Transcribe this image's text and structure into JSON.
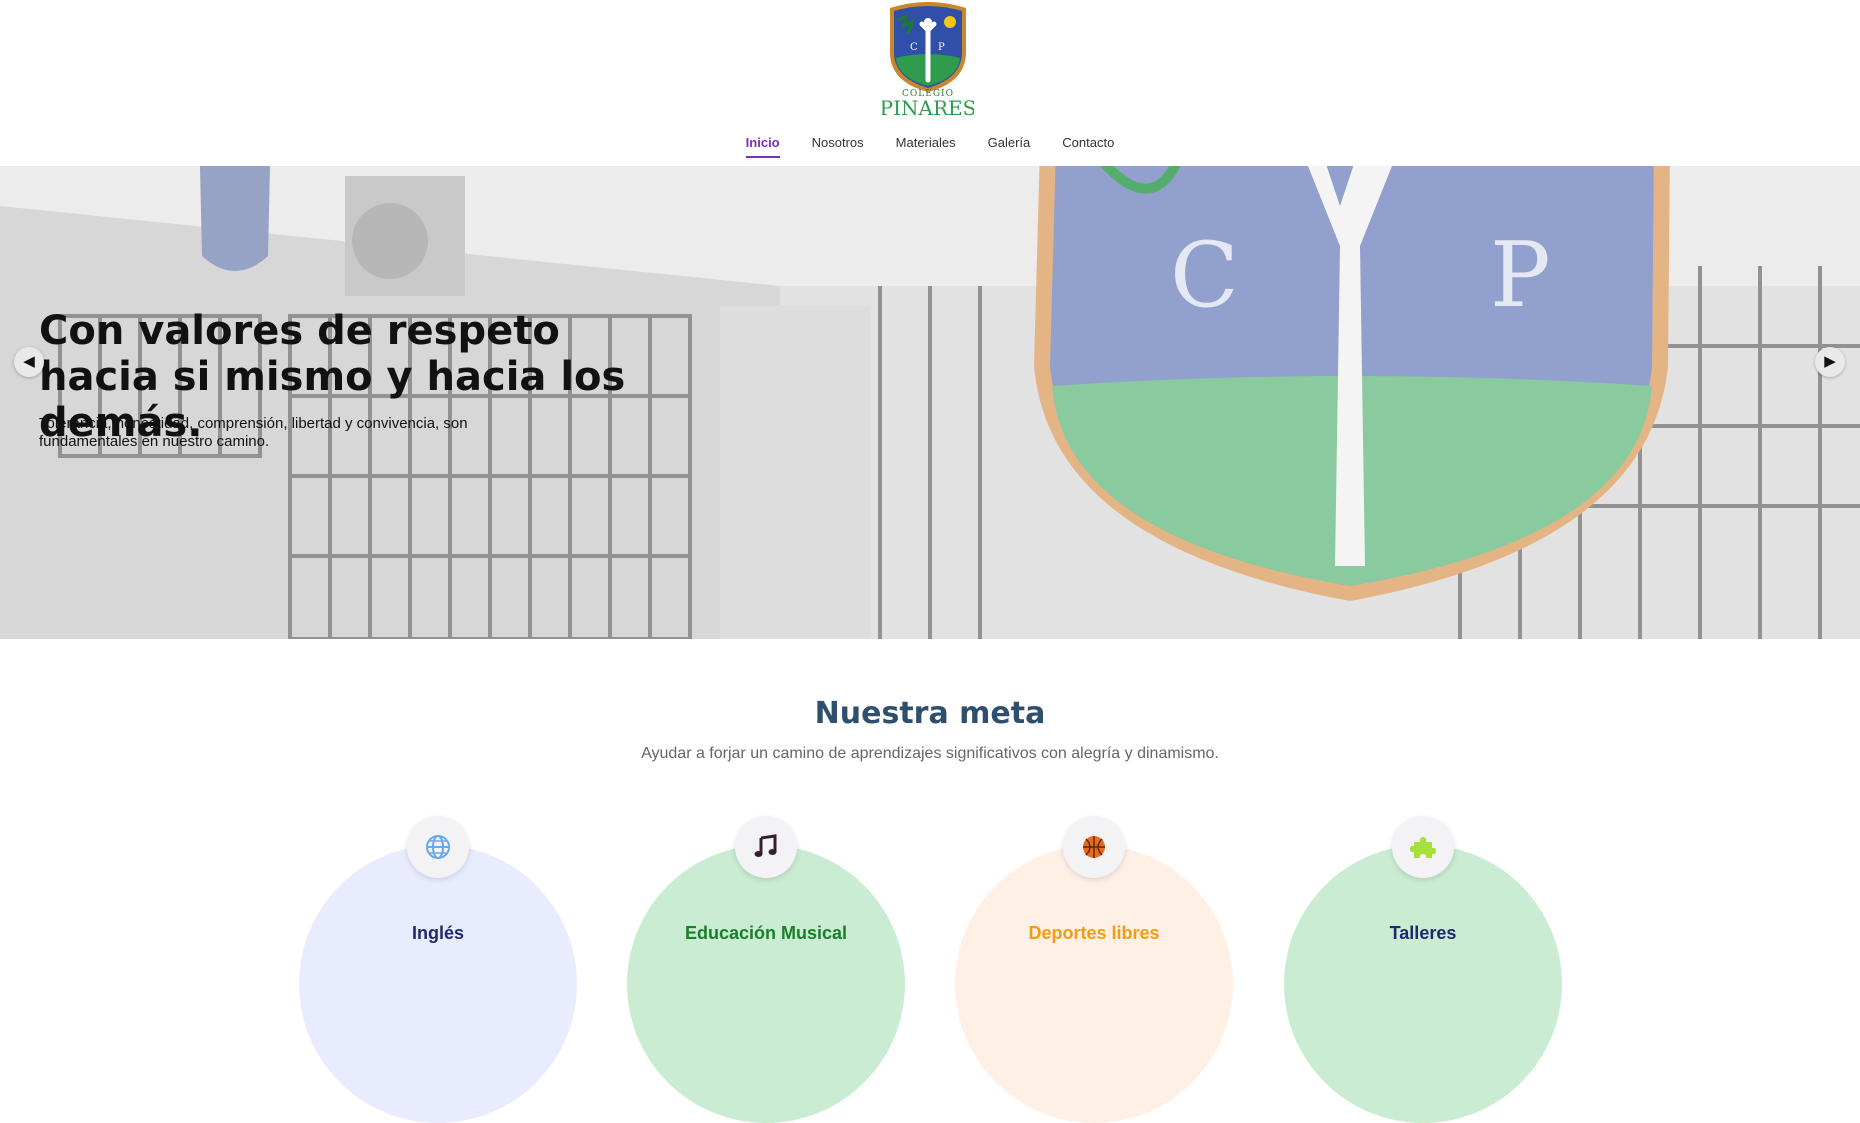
{
  "logo": {
    "school_word": "COLEGIO",
    "school_name": "PINARES",
    "letters": [
      "C",
      "P"
    ]
  },
  "nav": {
    "items": [
      {
        "label": "Inicio",
        "active": true
      },
      {
        "label": "Nosotros",
        "active": false
      },
      {
        "label": "Materiales",
        "active": false
      },
      {
        "label": "Galería",
        "active": false
      },
      {
        "label": "Contacto",
        "active": false
      }
    ]
  },
  "hero": {
    "title": "Con valores de respeto hacia si mismo y hacia los demás.",
    "text": "Tolerancia, honestidad, comprensión, libertad y convivencia, son fundamentales en nuestro camino.",
    "prev": "◀",
    "next": "▶"
  },
  "goal": {
    "title": "Nuestra meta",
    "subtitle": "Ayudar a forjar un camino de aprendizajes significativos con alegría y dinamismo."
  },
  "cards": [
    {
      "label": "Inglés",
      "icon": "globe-icon",
      "color": "#1f2a6e",
      "bg": "#e9ebff"
    },
    {
      "label": "Educación Musical",
      "icon": "music-note-icon",
      "color": "#1a7f2a",
      "bg": "#c9ecd2"
    },
    {
      "label": "Deportes libres",
      "icon": "basketball-icon",
      "color": "#f39c12",
      "bg": "#fff0e6"
    },
    {
      "label": "Talleres",
      "icon": "puzzle-icon",
      "color": "#1f2a6e",
      "bg": "#c9ecd2"
    }
  ],
  "colors": {
    "accent": "#7b2fbf",
    "heading": "#2f4f6f"
  }
}
